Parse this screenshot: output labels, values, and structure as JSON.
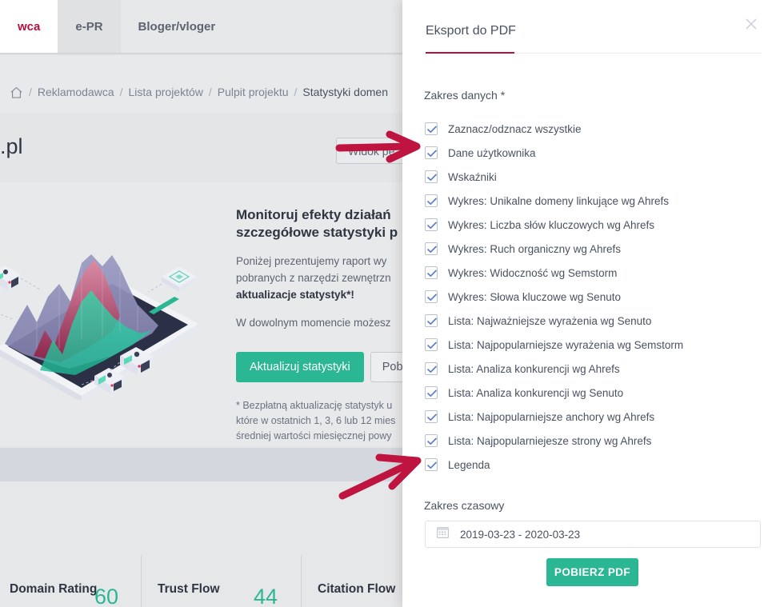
{
  "background": {
    "tabs": [
      {
        "label": "wca",
        "state": "active"
      },
      {
        "label": "e-PR",
        "state": "shade"
      },
      {
        "label": "Bloger/vloger",
        "state": "normal"
      }
    ],
    "breadcrumb": {
      "home_icon": "home-icon",
      "items": [
        "Reklamodawca",
        "Lista projektów",
        "Pulpit projektu",
        "Statystyki domen"
      ],
      "separator": "/"
    },
    "page_title": ".pl",
    "view_button": "Widok pe",
    "promo": {
      "heading_line1": "Monitoruj efekty działań",
      "heading_line2": "szczegółowe statystyki p",
      "para1_line1": "Poniżej prezentujemy raport wy",
      "para1_line2": "pobranych z narzędzi zewnętrzn",
      "para1_line3": "aktualizacje statystyk*!",
      "para2": "W dowolnym momencie możesz",
      "update_button": "Aktualizuj statystyki",
      "download_button": "Pobie",
      "footnote_line1": "* Bezpłatną aktualizację statystyk u",
      "footnote_line2": "które w ostatnich 1, 3, 6 lub 12 mies",
      "footnote_line3": "średniej wartości miesięcznej powy"
    },
    "metric_cards": [
      {
        "name": "Domain Rating",
        "value": "60"
      },
      {
        "name": "Trust Flow",
        "value": "44"
      },
      {
        "name": "Citation Flow",
        "value": ""
      }
    ],
    "illustration": "isometric-tablet-chart-illustration"
  },
  "panel": {
    "title": "Eksport do PDF",
    "close_icon": "close-icon",
    "accent_color": "#b4123c",
    "data_scope_label": "Zakres danych *",
    "checkboxes": [
      {
        "label": "Zaznacz/odznacz wszystkie",
        "checked": true
      },
      {
        "label": "Dane użytkownika",
        "checked": true
      },
      {
        "label": "Wskaźniki",
        "checked": true
      },
      {
        "label": "Wykres: Unikalne domeny linkujące wg Ahrefs",
        "checked": true
      },
      {
        "label": "Wykres: Liczba słów kluczowych wg Ahrefs",
        "checked": true
      },
      {
        "label": "Wykres: Ruch organiczny wg Ahrefs",
        "checked": true
      },
      {
        "label": "Wykres: Widoczność wg Semstorm",
        "checked": true
      },
      {
        "label": "Wykres: Słowa kluczowe wg Senuto",
        "checked": true
      },
      {
        "label": "Lista: Najważniejsze wyrażenia wg Senuto",
        "checked": true
      },
      {
        "label": "Lista: Najpopularniejsze wyrażenia wg Semstorm",
        "checked": true
      },
      {
        "label": "Lista: Analiza konkurencji wg Ahrefs",
        "checked": true
      },
      {
        "label": "Lista: Analiza konkurencji wg Senuto",
        "checked": true
      },
      {
        "label": "Lista: Najpopularniejsze anchory wg Ahrefs",
        "checked": true
      },
      {
        "label": "Lista: Najpopularniejesze strony wg Ahrefs",
        "checked": true
      },
      {
        "label": "Legenda",
        "checked": true
      }
    ],
    "time_scope_label": "Zakres czasowy",
    "date_range": {
      "icon": "calendar-icon",
      "value": "2019-03-23 - 2020-03-23"
    },
    "download_pdf_button": "POBIERZ PDF",
    "button_color": "#2bb793"
  },
  "annotations": {
    "arrow_color": "#bf1440",
    "arrows": [
      {
        "name": "arrow-to-view-button",
        "points_to": "Widok pe button"
      },
      {
        "name": "arrow-to-legenda-checkbox",
        "points_to": "Legenda checkbox"
      }
    ]
  }
}
